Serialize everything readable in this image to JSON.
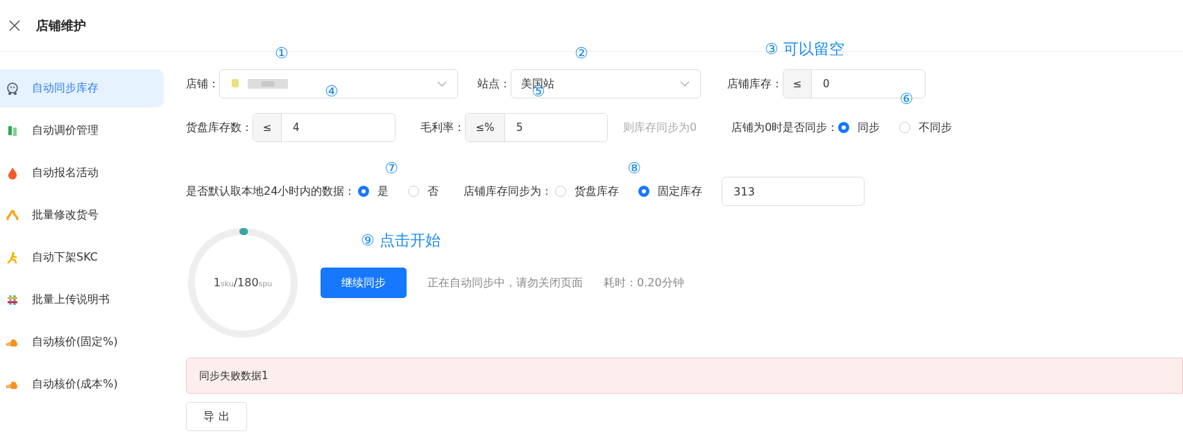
{
  "header": {
    "title": "店铺维护"
  },
  "sidebar": {
    "items": [
      {
        "label": "自动同步库存",
        "selected": true
      },
      {
        "label": "自动调价管理",
        "selected": false
      },
      {
        "label": "自动报名活动",
        "selected": false
      },
      {
        "label": "批量修改货号",
        "selected": false
      },
      {
        "label": "自动下架SKC",
        "selected": false
      },
      {
        "label": "批量上传说明书",
        "selected": false
      },
      {
        "label": "自动核价(固定%)",
        "selected": false
      },
      {
        "label": "自动核价(成本%)",
        "selected": false
      }
    ]
  },
  "form": {
    "store": {
      "label": "店铺：",
      "annotation": "①"
    },
    "site": {
      "label": "站点：",
      "value": "美国站",
      "annotation": "②"
    },
    "shop_stock": {
      "label": "店铺库存：",
      "prefix": "≤",
      "value": "0",
      "annotation": "③ 可以留空"
    },
    "pallet_stock": {
      "label": "货盘库存数：",
      "prefix": "≤",
      "value": "4",
      "annotation": "④"
    },
    "margin": {
      "label": "毛利率：",
      "prefix": "≤%",
      "value": "5",
      "annotation": "⑤"
    },
    "hint": "则库存同步为0",
    "sync_zero": {
      "label": "店铺为0时是否同步：",
      "annotation": "⑥",
      "options": [
        {
          "label": "同步",
          "selected": true
        },
        {
          "label": "不同步",
          "selected": false
        }
      ]
    },
    "local_data": {
      "label": "是否默认取本地24小时内的数据：",
      "annotation": "⑦",
      "options": [
        {
          "label": "是",
          "selected": true
        },
        {
          "label": "否",
          "selected": false
        }
      ]
    },
    "sync_to": {
      "label": "店铺库存同步为：",
      "annotation": "⑧",
      "options": [
        {
          "label": "货盘库存",
          "selected": false
        },
        {
          "label": "固定库存",
          "selected": true
        }
      ],
      "value": "313"
    }
  },
  "progress": {
    "level": 0.0056,
    "text": "1$_{sku}$/180$_{spu}$"
  },
  "action": {
    "button": "继续同步",
    "annotation": "⑨ 点击开始",
    "status": "正在自动同步中，请勿关闭页面",
    "elapsed": "耗时：0.20分钟"
  },
  "alert": {
    "text": "同步失败数据1"
  },
  "export_button": "导 出"
}
